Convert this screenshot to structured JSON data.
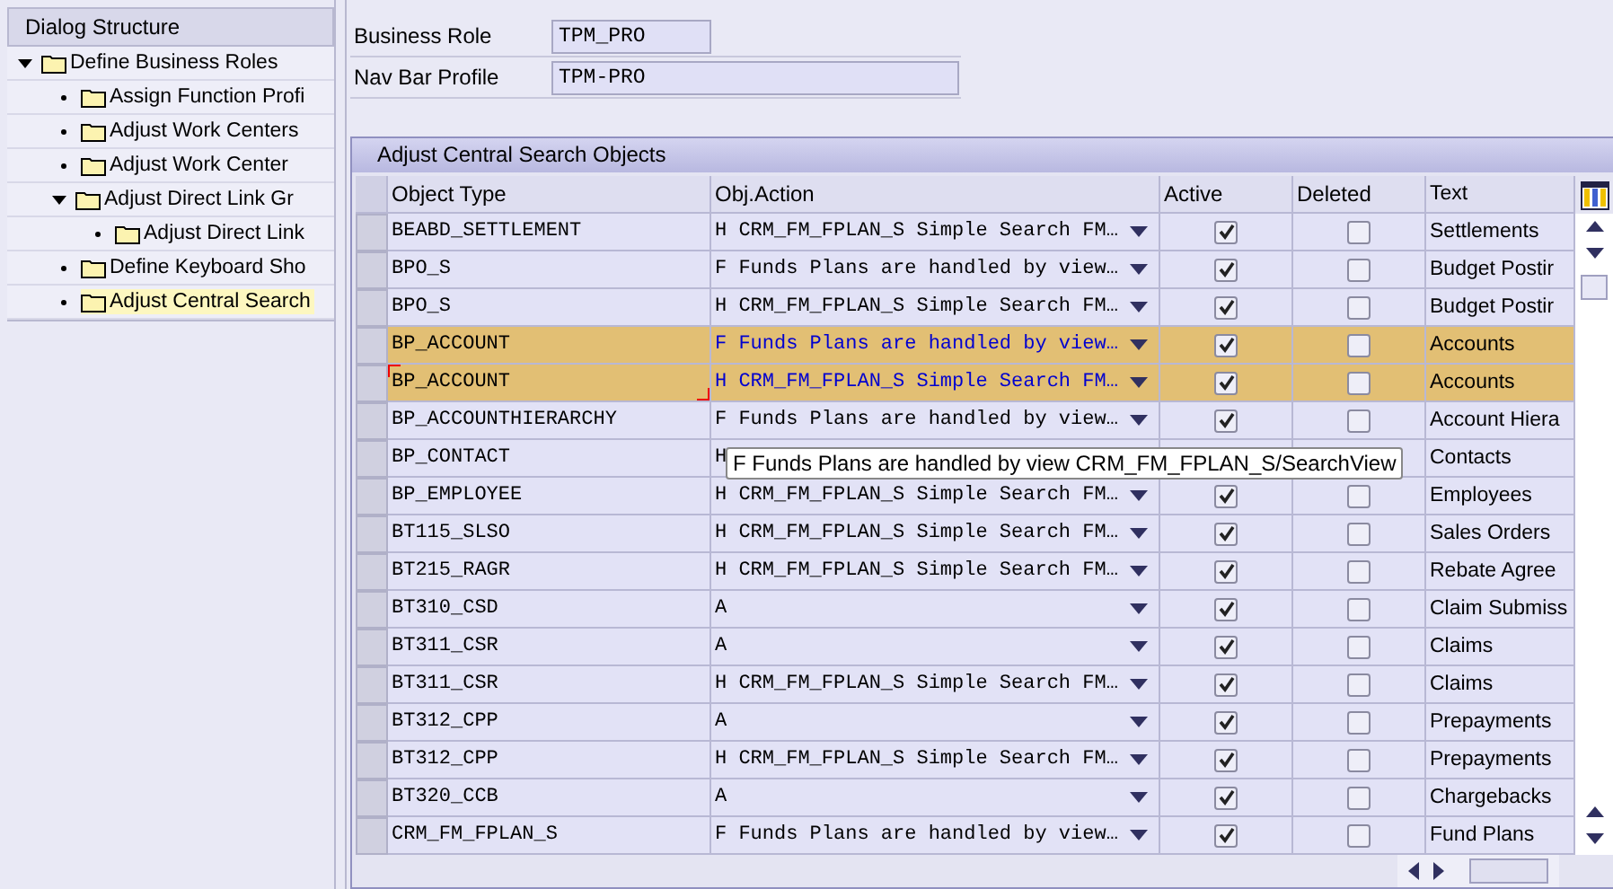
{
  "dialog_structure": {
    "title": "Dialog Structure",
    "items": [
      {
        "label": "Define Business Roles",
        "expanded": true,
        "selected": false,
        "children": [
          {
            "label": "Assign Function Profi",
            "selected": false
          },
          {
            "label": "Adjust Work Centers",
            "selected": false
          },
          {
            "label": "Adjust Work Center",
            "selected": false
          },
          {
            "label": "Adjust Direct Link Gr",
            "expanded": true,
            "selected": false,
            "children": [
              {
                "label": "Adjust Direct Link",
                "selected": false
              }
            ]
          },
          {
            "label": "Define Keyboard Sho",
            "selected": false
          },
          {
            "label": "Adjust Central Search",
            "selected": true
          }
        ]
      }
    ]
  },
  "fields": [
    {
      "label": "Business Role",
      "value": "TPM_PRO"
    },
    {
      "label": "Nav Bar Profile",
      "value": "TPM-PRO"
    }
  ],
  "table": {
    "title": "Adjust Central Search Objects",
    "columns": [
      "Object Type",
      "Obj.Action",
      "Active",
      "Deleted",
      "Text"
    ],
    "rows": [
      {
        "object_type": "BEABD_SETTLEMENT",
        "action": "H CRM_FM_FPLAN_S Simple Search FM…",
        "active": true,
        "deleted": false,
        "text": "Settlements",
        "selected": false
      },
      {
        "object_type": "BPO_S",
        "action": "F Funds Plans are handled by view…",
        "active": true,
        "deleted": false,
        "text": "Budget Postir",
        "selected": false
      },
      {
        "object_type": "BPO_S",
        "action": "H CRM_FM_FPLAN_S Simple Search FM…",
        "active": true,
        "deleted": false,
        "text": "Budget Postir",
        "selected": false
      },
      {
        "object_type": "BP_ACCOUNT",
        "action": "F Funds Plans are handled by view…",
        "active": true,
        "deleted": false,
        "text": "Accounts",
        "selected": true
      },
      {
        "object_type": "BP_ACCOUNT",
        "action": "H CRM_FM_FPLAN_S Simple Search FM…",
        "active": true,
        "deleted": false,
        "text": "Accounts",
        "selected": true,
        "focused": true
      },
      {
        "object_type": "BP_ACCOUNTHIERARCHY",
        "action": "F Funds Plans are handled by view…",
        "active": true,
        "deleted": false,
        "text": "Account Hiera",
        "selected": false
      },
      {
        "object_type": "BP_CONTACT",
        "action": "H",
        "tooltip": "F Funds Plans are handled by view CRM_FM_FPLAN_S/SearchView",
        "text": "Contacts",
        "selected": false
      },
      {
        "object_type": "BP_EMPLOYEE",
        "action": "H CRM_FM_FPLAN_S Simple Search FM…",
        "active": true,
        "deleted": false,
        "text": "Employees",
        "selected": false
      },
      {
        "object_type": "BT115_SLSO",
        "action": "H CRM_FM_FPLAN_S Simple Search FM…",
        "active": true,
        "deleted": false,
        "text": "Sales Orders",
        "selected": false
      },
      {
        "object_type": "BT215_RAGR",
        "action": "H CRM_FM_FPLAN_S Simple Search FM…",
        "active": true,
        "deleted": false,
        "text": "Rebate Agree",
        "selected": false
      },
      {
        "object_type": "BT310_CSD",
        "action": "A",
        "active": true,
        "deleted": false,
        "text": "Claim Submiss",
        "selected": false
      },
      {
        "object_type": "BT311_CSR",
        "action": "A",
        "active": true,
        "deleted": false,
        "text": "Claims",
        "selected": false
      },
      {
        "object_type": "BT311_CSR",
        "action": "H CRM_FM_FPLAN_S Simple Search FM…",
        "active": true,
        "deleted": false,
        "text": "Claims",
        "selected": false
      },
      {
        "object_type": "BT312_CPP",
        "action": "A",
        "active": true,
        "deleted": false,
        "text": "Prepayments",
        "selected": false
      },
      {
        "object_type": "BT312_CPP",
        "action": "H CRM_FM_FPLAN_S Simple Search FM…",
        "active": true,
        "deleted": false,
        "text": "Prepayments",
        "selected": false
      },
      {
        "object_type": "BT320_CCB",
        "action": "A",
        "active": true,
        "deleted": false,
        "text": "Chargebacks",
        "selected": false
      },
      {
        "object_type": "CRM_FM_FPLAN_S",
        "action": "F Funds Plans are handled by view…",
        "active": true,
        "deleted": false,
        "text": "Fund Plans",
        "selected": false
      }
    ]
  }
}
